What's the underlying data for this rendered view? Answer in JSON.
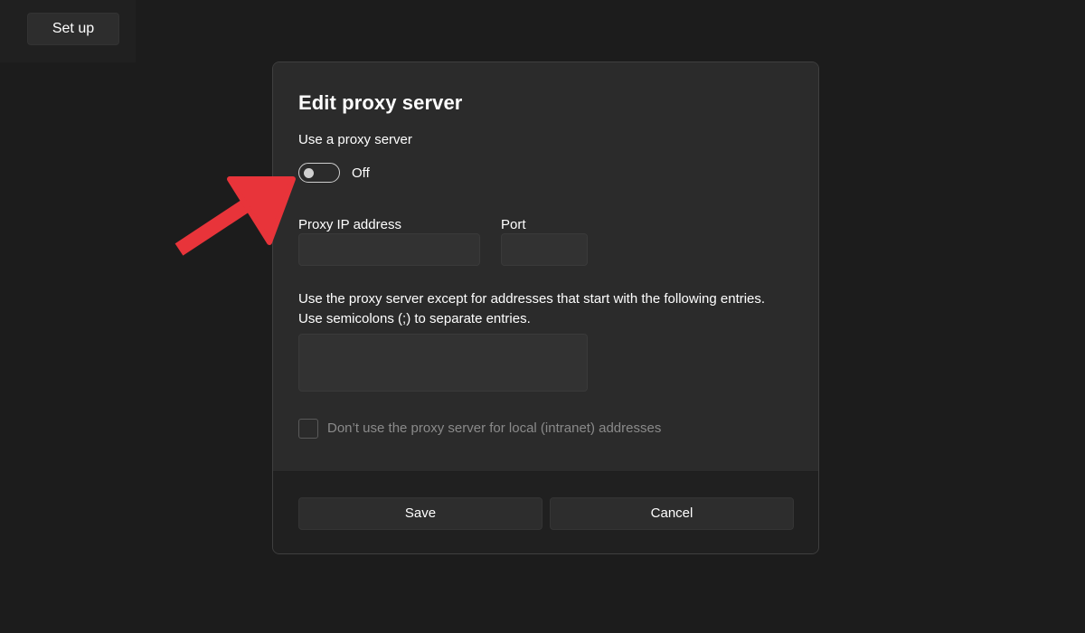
{
  "background": {
    "setup_button_label": "Set up"
  },
  "dialog": {
    "title": "Edit proxy server",
    "use_proxy_label": "Use a proxy server",
    "toggle_state_label": "Off",
    "proxy_ip_label": "Proxy IP address",
    "proxy_ip_value": "",
    "port_label": "Port",
    "port_value": "",
    "exceptions_description_line1": "Use the proxy server except for addresses that start with the following entries.",
    "exceptions_description_line2": "Use semicolons (;) to separate entries.",
    "exceptions_value": "",
    "local_checkbox_label": "Don’t use the proxy server for local (intranet) addresses",
    "save_label": "Save",
    "cancel_label": "Cancel"
  },
  "annotation": {
    "arrow_color": "#e8343a",
    "arrow_icon": "red-arrow-pointing-to-toggle"
  },
  "colors": {
    "page_background": "#1c1c1c",
    "dialog_background": "#2b2b2b",
    "footer_background": "#202020",
    "disabled_text": "#8a8a8a"
  }
}
